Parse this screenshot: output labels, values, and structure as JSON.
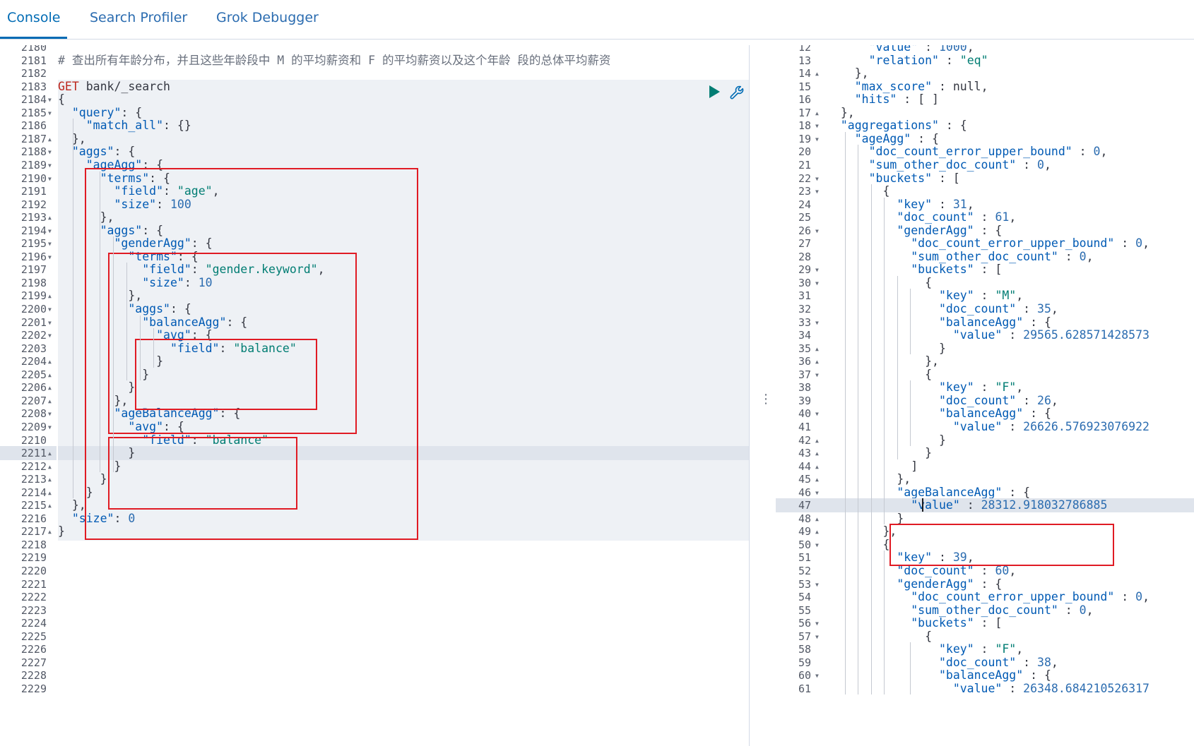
{
  "tabs": [
    {
      "label": "Console",
      "active": true
    },
    {
      "label": "Search Profiler",
      "active": false
    },
    {
      "label": "Grok Debugger",
      "active": false
    }
  ],
  "request_editor": {
    "first_line_number": 2180,
    "lines": [
      {
        "n": "2180",
        "fold": "",
        "text": ""
      },
      {
        "n": "2181",
        "fold": "",
        "text": "# 查出所有年龄分布，并且这些年龄段中 M 的平均薪资和 F 的平均薪资以及这个年龄 段的总体平均薪资"
      },
      {
        "n": "2182",
        "fold": "",
        "text": ""
      },
      {
        "n": "2183",
        "fold": "",
        "text": "GET bank/_search"
      },
      {
        "n": "2184",
        "fold": "down",
        "text": "{"
      },
      {
        "n": "2185",
        "fold": "down",
        "text": "  \"query\": {"
      },
      {
        "n": "2186",
        "fold": "",
        "text": "    \"match_all\": {}"
      },
      {
        "n": "2187",
        "fold": "up",
        "text": "  },"
      },
      {
        "n": "2188",
        "fold": "down",
        "text": "  \"aggs\": {"
      },
      {
        "n": "2189",
        "fold": "down",
        "text": "    \"ageAgg\": {"
      },
      {
        "n": "2190",
        "fold": "down",
        "text": "      \"terms\": {"
      },
      {
        "n": "2191",
        "fold": "",
        "text": "        \"field\": \"age\","
      },
      {
        "n": "2192",
        "fold": "",
        "text": "        \"size\": 100"
      },
      {
        "n": "2193",
        "fold": "up",
        "text": "      },"
      },
      {
        "n": "2194",
        "fold": "down",
        "text": "      \"aggs\": {"
      },
      {
        "n": "2195",
        "fold": "down",
        "text": "        \"genderAgg\": {"
      },
      {
        "n": "2196",
        "fold": "down",
        "text": "          \"terms\": {"
      },
      {
        "n": "2197",
        "fold": "",
        "text": "            \"field\": \"gender.keyword\","
      },
      {
        "n": "2198",
        "fold": "",
        "text": "            \"size\": 10"
      },
      {
        "n": "2199",
        "fold": "up",
        "text": "          },"
      },
      {
        "n": "2200",
        "fold": "down",
        "text": "          \"aggs\": {"
      },
      {
        "n": "2201",
        "fold": "down",
        "text": "            \"balanceAgg\": {"
      },
      {
        "n": "2202",
        "fold": "down",
        "text": "              \"avg\": {"
      },
      {
        "n": "2203",
        "fold": "",
        "text": "                \"field\": \"balance\""
      },
      {
        "n": "2204",
        "fold": "up",
        "text": "              }"
      },
      {
        "n": "2205",
        "fold": "up",
        "text": "            }"
      },
      {
        "n": "2206",
        "fold": "up",
        "text": "          }"
      },
      {
        "n": "2207",
        "fold": "up",
        "text": "        },"
      },
      {
        "n": "2208",
        "fold": "down",
        "text": "        \"ageBalanceAgg\": {"
      },
      {
        "n": "2209",
        "fold": "down",
        "text": "          \"avg\": {"
      },
      {
        "n": "2210",
        "fold": "",
        "text": "            \"field\": \"balance\""
      },
      {
        "n": "2211",
        "fold": "up",
        "text": "          }"
      },
      {
        "n": "2212",
        "fold": "up",
        "text": "        }"
      },
      {
        "n": "2213",
        "fold": "up",
        "text": "      }"
      },
      {
        "n": "2214",
        "fold": "up",
        "text": "    }"
      },
      {
        "n": "2215",
        "fold": "up",
        "text": "  },"
      },
      {
        "n": "2216",
        "fold": "",
        "text": "  \"size\": 0"
      },
      {
        "n": "2217",
        "fold": "up",
        "text": "}"
      },
      {
        "n": "2218",
        "fold": "",
        "text": ""
      },
      {
        "n": "2219",
        "fold": "",
        "text": ""
      },
      {
        "n": "2220",
        "fold": "",
        "text": ""
      },
      {
        "n": "2221",
        "fold": "",
        "text": ""
      },
      {
        "n": "2222",
        "fold": "",
        "text": ""
      },
      {
        "n": "2223",
        "fold": "",
        "text": ""
      },
      {
        "n": "2224",
        "fold": "",
        "text": ""
      },
      {
        "n": "2225",
        "fold": "",
        "text": ""
      },
      {
        "n": "2226",
        "fold": "",
        "text": ""
      },
      {
        "n": "2227",
        "fold": "",
        "text": ""
      },
      {
        "n": "2228",
        "fold": "",
        "text": ""
      },
      {
        "n": "2229",
        "fold": "",
        "text": ""
      }
    ],
    "active_line": "2211",
    "actions": {
      "run_icon": "play-icon",
      "settings_icon": "wrench-icon"
    }
  },
  "response_viewer": {
    "first_line_number": 12,
    "lines": [
      {
        "n": "12",
        "fold": "",
        "text": "      \"value\" : 1000,"
      },
      {
        "n": "13",
        "fold": "",
        "text": "      \"relation\" : \"eq\""
      },
      {
        "n": "14",
        "fold": "up",
        "text": "    },"
      },
      {
        "n": "15",
        "fold": "",
        "text": "    \"max_score\" : null,"
      },
      {
        "n": "16",
        "fold": "",
        "text": "    \"hits\" : [ ]"
      },
      {
        "n": "17",
        "fold": "up",
        "text": "  },"
      },
      {
        "n": "18",
        "fold": "down",
        "text": "  \"aggregations\" : {"
      },
      {
        "n": "19",
        "fold": "down",
        "text": "    \"ageAgg\" : {"
      },
      {
        "n": "20",
        "fold": "",
        "text": "      \"doc_count_error_upper_bound\" : 0,"
      },
      {
        "n": "21",
        "fold": "",
        "text": "      \"sum_other_doc_count\" : 0,"
      },
      {
        "n": "22",
        "fold": "down",
        "text": "      \"buckets\" : ["
      },
      {
        "n": "23",
        "fold": "down",
        "text": "        {"
      },
      {
        "n": "24",
        "fold": "",
        "text": "          \"key\" : 31,"
      },
      {
        "n": "25",
        "fold": "",
        "text": "          \"doc_count\" : 61,"
      },
      {
        "n": "26",
        "fold": "down",
        "text": "          \"genderAgg\" : {"
      },
      {
        "n": "27",
        "fold": "",
        "text": "            \"doc_count_error_upper_bound\" : 0,"
      },
      {
        "n": "28",
        "fold": "",
        "text": "            \"sum_other_doc_count\" : 0,"
      },
      {
        "n": "29",
        "fold": "down",
        "text": "            \"buckets\" : ["
      },
      {
        "n": "30",
        "fold": "down",
        "text": "              {"
      },
      {
        "n": "31",
        "fold": "",
        "text": "                \"key\" : \"M\","
      },
      {
        "n": "32",
        "fold": "",
        "text": "                \"doc_count\" : 35,"
      },
      {
        "n": "33",
        "fold": "down",
        "text": "                \"balanceAgg\" : {"
      },
      {
        "n": "34",
        "fold": "",
        "text": "                  \"value\" : 29565.628571428573"
      },
      {
        "n": "35",
        "fold": "up",
        "text": "                }"
      },
      {
        "n": "36",
        "fold": "up",
        "text": "              },"
      },
      {
        "n": "37",
        "fold": "down",
        "text": "              {"
      },
      {
        "n": "38",
        "fold": "",
        "text": "                \"key\" : \"F\","
      },
      {
        "n": "39",
        "fold": "",
        "text": "                \"doc_count\" : 26,"
      },
      {
        "n": "40",
        "fold": "down",
        "text": "                \"balanceAgg\" : {"
      },
      {
        "n": "41",
        "fold": "",
        "text": "                  \"value\" : 26626.576923076922"
      },
      {
        "n": "42",
        "fold": "up",
        "text": "                }"
      },
      {
        "n": "43",
        "fold": "up",
        "text": "              }"
      },
      {
        "n": "44",
        "fold": "up",
        "text": "            ]"
      },
      {
        "n": "45",
        "fold": "up",
        "text": "          },"
      },
      {
        "n": "46",
        "fold": "down",
        "text": "          \"ageBalanceAgg\" : {"
      },
      {
        "n": "47",
        "fold": "",
        "text": "            \"value\" : 28312.918032786885"
      },
      {
        "n": "48",
        "fold": "up",
        "text": "          }"
      },
      {
        "n": "49",
        "fold": "up",
        "text": "        },"
      },
      {
        "n": "50",
        "fold": "down",
        "text": "        {"
      },
      {
        "n": "51",
        "fold": "",
        "text": "          \"key\" : 39,"
      },
      {
        "n": "52",
        "fold": "",
        "text": "          \"doc_count\" : 60,"
      },
      {
        "n": "53",
        "fold": "down",
        "text": "          \"genderAgg\" : {"
      },
      {
        "n": "54",
        "fold": "",
        "text": "            \"doc_count_error_upper_bound\" : 0,"
      },
      {
        "n": "55",
        "fold": "",
        "text": "            \"sum_other_doc_count\" : 0,"
      },
      {
        "n": "56",
        "fold": "down",
        "text": "            \"buckets\" : ["
      },
      {
        "n": "57",
        "fold": "down",
        "text": "              {"
      },
      {
        "n": "58",
        "fold": "",
        "text": "                \"key\" : \"F\","
      },
      {
        "n": "59",
        "fold": "",
        "text": "                \"doc_count\" : 38,"
      },
      {
        "n": "60",
        "fold": "down",
        "text": "                \"balanceAgg\" : {"
      },
      {
        "n": "61",
        "fold": "",
        "text": "                  \"value\" : 26348.684210526317"
      }
    ],
    "active_line": "47"
  },
  "divider_icon": "vertical-ellipsis-icon",
  "colors": {
    "accent": "#006bb4",
    "highlight_box": "#e01b24",
    "json_key": "#005ab4",
    "json_string": "#017d73",
    "http_method": "#bd271e",
    "request_background": "#eef1f5"
  }
}
